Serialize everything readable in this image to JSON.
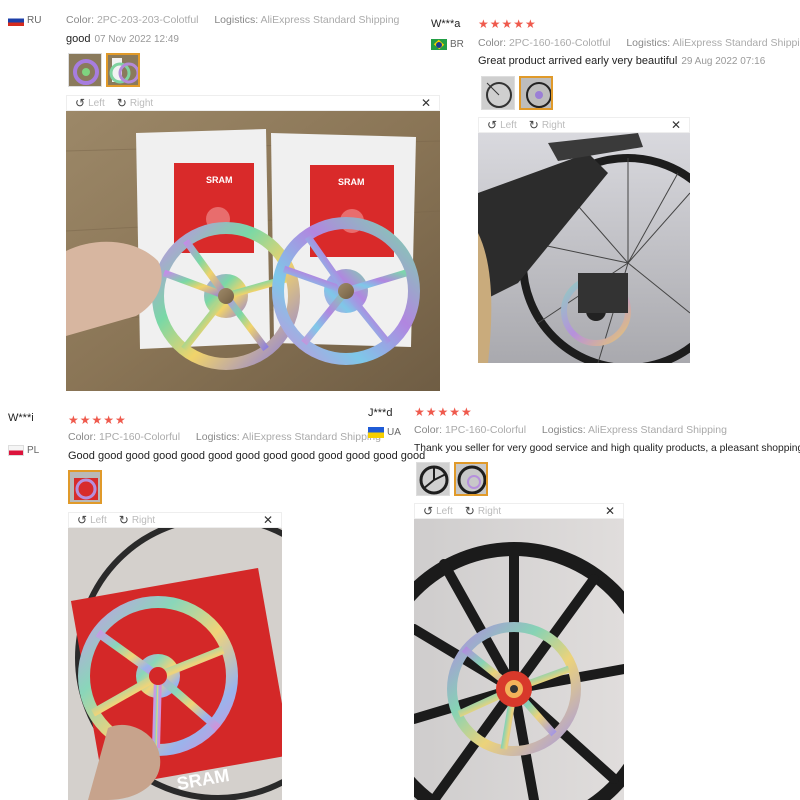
{
  "labels": {
    "color": "Color:",
    "logistics": "Logistics:",
    "left": "Left",
    "right": "Right"
  },
  "reviews": [
    {
      "user": "",
      "country": "RU",
      "stars": "★★★★★",
      "color": "2PC-203-203-Colotful",
      "logistics": "AliExpress Standard Shipping",
      "text": "good",
      "date": "07 Nov 2022 12:49"
    },
    {
      "user": "W***a",
      "country": "BR",
      "stars": "★★★★★",
      "color": "2PC-160-160-Colotful",
      "logistics": "AliExpress Standard Shipping",
      "text": "Great product arrived early very beautiful",
      "date": "29 Aug 2022 07:16"
    },
    {
      "user": "W***i",
      "country": "PL",
      "stars": "★★★★★",
      "color": "1PC-160-Colorful",
      "logistics": "AliExpress Standard Shipping",
      "text": "Good good good good good good good good good good good good good",
      "date": ""
    },
    {
      "user": "J***d",
      "country": "UA",
      "stars": "★★★★★",
      "color": "1PC-160-Colorful",
      "logistics": "AliExpress Standard Shipping",
      "text": "Thank you seller for very good service and high quality products, a pleasant shopping.",
      "date": ""
    }
  ],
  "photo_text": {
    "brand": "SRAM"
  },
  "colors": {
    "stars": "#ef5a4d",
    "thumb_active": "#e09a2a"
  }
}
